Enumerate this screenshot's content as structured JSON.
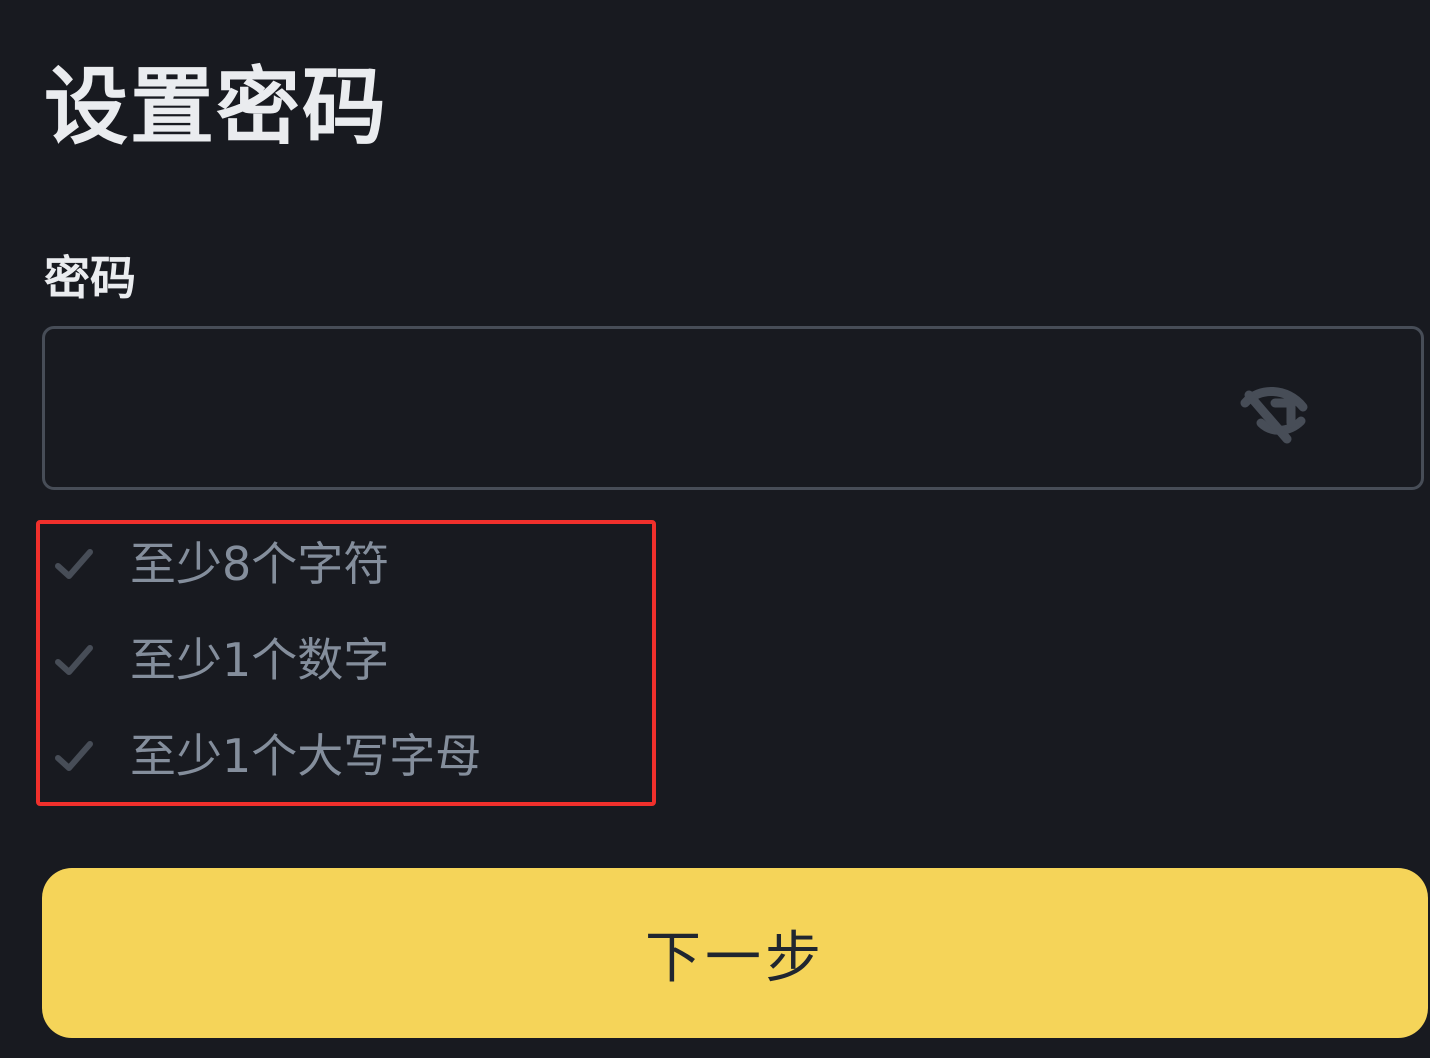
{
  "page": {
    "title": "设置密码"
  },
  "password_field": {
    "label": "密码",
    "value": "",
    "visibility_icon": "eye-off-icon"
  },
  "requirements": [
    {
      "text": "至少8个字符",
      "icon": "check-icon"
    },
    {
      "text": "至少1个数字",
      "icon": "check-icon"
    },
    {
      "text": "至少1个大写字母",
      "icon": "check-icon"
    }
  ],
  "next_button": {
    "label": "下一步"
  },
  "colors": {
    "background": "#181a20",
    "text_primary": "#eaecef",
    "text_secondary": "#848e9c",
    "input_border": "#474d57",
    "accent_button": "#f5d459",
    "highlight_box": "#f0302c"
  }
}
